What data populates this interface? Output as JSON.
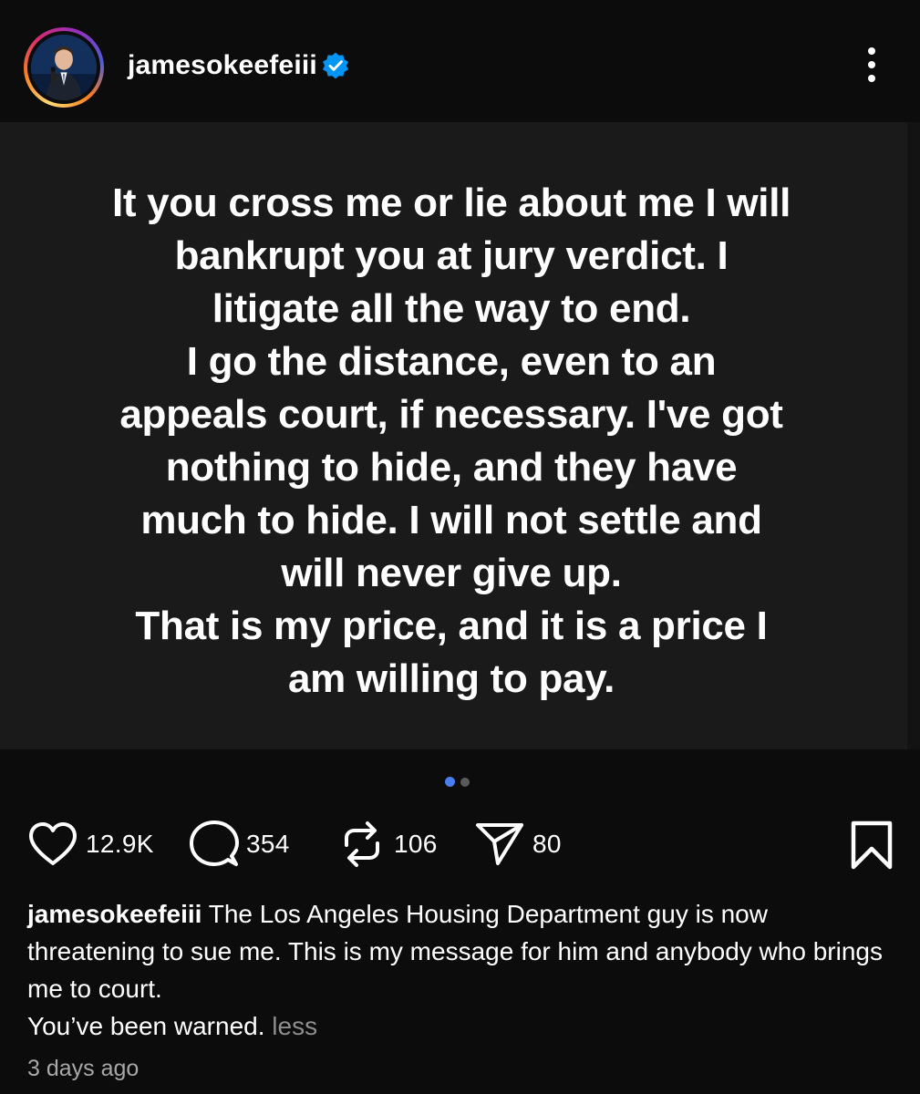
{
  "header": {
    "username": "jamesokeefeiii",
    "verified_icon": "verified-badge-icon",
    "more_icon": "more-options-icon"
  },
  "post": {
    "text_lines": [
      "It you cross me or lie about me I will",
      "bankrupt you at jury verdict. I",
      "litigate all the way to end.",
      "I go the distance, even to an",
      "appeals court, if necessary. I've got",
      "nothing to hide, and they have",
      "much to hide. I will not settle and",
      "will never give up.",
      "That is my price, and it is a price I",
      "am willing to pay."
    ],
    "carousel": {
      "total": 2,
      "active": 1
    }
  },
  "actions": {
    "likes": "12.9K",
    "comments": "354",
    "reposts": "106",
    "shares": "80"
  },
  "caption": {
    "username": "jamesokeefeiii",
    "text": " The Los Angeles Housing Department guy is now threatening to sue me. This is my message for him and anybody who brings me to court.",
    "text2": "You’ve been warned.",
    "less_label": "less"
  },
  "timestamp": "3 days ago",
  "colors": {
    "accent_blue": "#4a7df0",
    "verified_blue": "#0095f6",
    "background": "#0c0c0c",
    "post_background": "#1a1a1a"
  }
}
